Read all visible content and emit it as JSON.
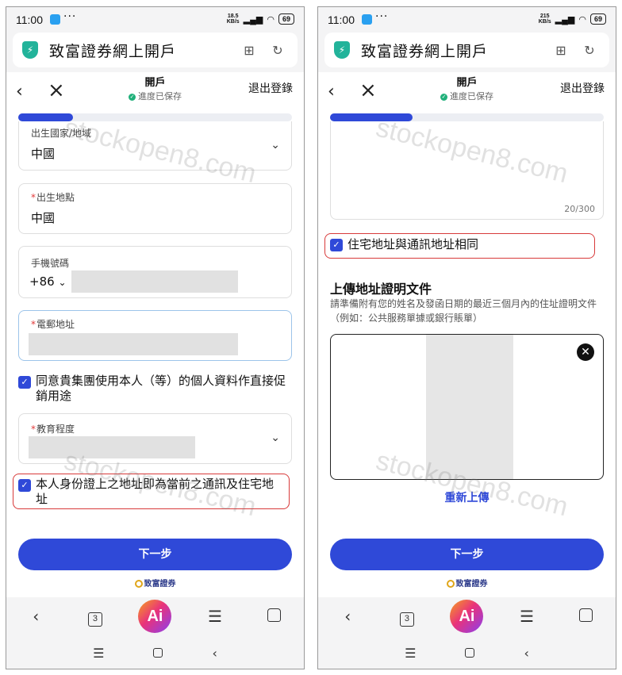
{
  "status": {
    "time": "11:00",
    "dots": "···",
    "left_speed_value": "18.5",
    "right_speed_value": "215",
    "speed_unit": "KB/s",
    "battery": "69"
  },
  "browser": {
    "title": "致富證券網上開戶"
  },
  "nav": {
    "title": "開戶",
    "saved": "進度已保存",
    "logout": "退出登錄"
  },
  "progress": {
    "left": 0.2,
    "right": 0.3
  },
  "left": {
    "birth_country": {
      "label": "出生國家/地域",
      "value": "中國"
    },
    "birth_place": {
      "label": "出生地點",
      "value": "中國"
    },
    "phone": {
      "label": "手機號碼",
      "code": "+86"
    },
    "email": {
      "label": "電郵地址"
    },
    "consent": "同意貴集團使用本人（等）的個人資料作直接促銷用途",
    "education": {
      "label": "教育程度"
    },
    "id_address": "本人身份證上之地址即為當前之通訊及住宅地址"
  },
  "right": {
    "counter": "20/300",
    "same_address": "住宅地址與通訊地址相同",
    "upload_title": "上傳地址證明文件",
    "upload_desc": "請準備附有您的姓名及發函日期的最近三個月內的住址證明文件（例如：公共服務單據或銀行賬單）",
    "reupload": "重新上傳"
  },
  "next_button": "下一步",
  "brand": "致富證券",
  "watermark": "stockopen8.com",
  "bottom": {
    "tabs_count": "3",
    "ai": "Ai"
  },
  "colors": {
    "accent": "#2f49d8",
    "highlight": "#d83a3a",
    "shield": "#22b39a"
  }
}
